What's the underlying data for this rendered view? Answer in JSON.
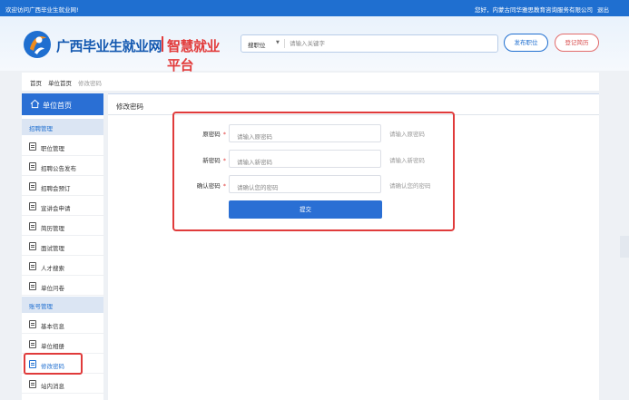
{
  "topbar": {
    "welcome": "欢迎访问广西毕业生就业网!",
    "user": "您好，内蒙古同华雅思教育咨询服务有限公司",
    "logout": "退出"
  },
  "header": {
    "logo_main": "广西毕业生就业网",
    "logo_sub": "智慧就业平台",
    "search_type": "搜职位",
    "search_placeholder": "请输入关键字",
    "btn_publish": "发布职位",
    "btn_resume": "登记简历",
    "colors": {
      "brand_blue": "#1f6fd0",
      "brand_red": "#e23b3b",
      "logo_orange": "#f08c1c"
    }
  },
  "breadcrumb": [
    "首页",
    "单位首页",
    "修改密码"
  ],
  "sidebar": {
    "home": "单位首页",
    "groups": [
      {
        "title": "招聘管理",
        "items": [
          "职位管理",
          "招聘公告发布",
          "招聘会预订",
          "宣讲会申请",
          "简历管理",
          "面试管理",
          "人才搜索",
          "单位问卷"
        ]
      },
      {
        "title": "账号管理",
        "items": [
          "基本信息",
          "单位相册",
          "修改密码",
          "站内消息"
        ]
      }
    ],
    "active_item": "修改密码"
  },
  "main": {
    "title": "修改密码",
    "fields": [
      {
        "label": "原密码",
        "placeholder": "请输入原密码",
        "hint": "请输入原密码"
      },
      {
        "label": "新密码",
        "placeholder": "请输入新密码",
        "hint": "请输入新密码"
      },
      {
        "label": "确认密码",
        "placeholder": "请确认您的密码",
        "hint": "请确认您的密码"
      }
    ],
    "required_mark": "*",
    "submit": "提交"
  }
}
